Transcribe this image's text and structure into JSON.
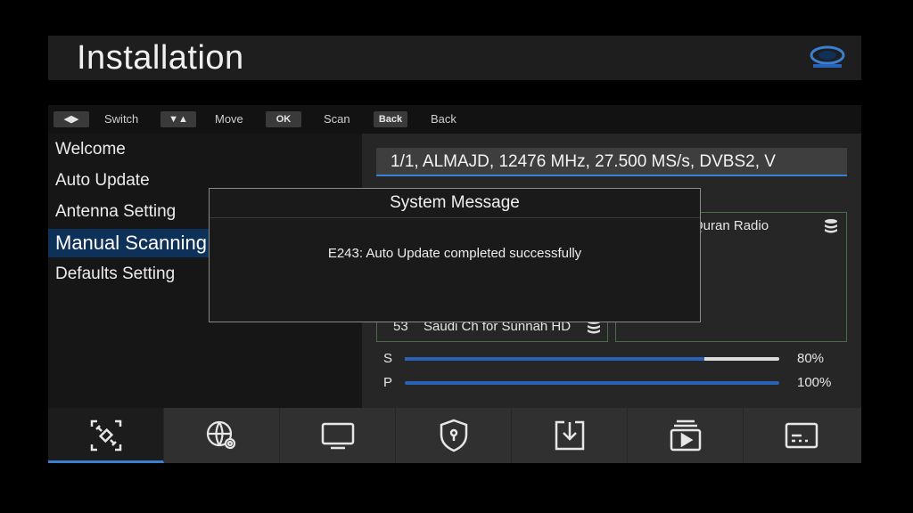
{
  "header": {
    "title": "Installation"
  },
  "hints": {
    "keys": [
      "◀▶",
      "▼▲",
      "OK",
      "Back"
    ],
    "labels": [
      "Switch",
      "Move",
      "Scan",
      "Back"
    ]
  },
  "menu": {
    "items": [
      "Welcome",
      "Auto Update",
      "Antenna Setting",
      "Manual Scanning",
      "Defaults Setting"
    ],
    "selected": "Manual Scanning"
  },
  "transponder": {
    "value": "1/1, ALMAJD, 12476 MHz, 27.500 MS/s, DVBS2, V"
  },
  "channels": {
    "left": {
      "number": "53",
      "name": "Saudi Ch for Sunnah HD"
    },
    "right": {
      "name": "Quran Radio"
    }
  },
  "signal": {
    "strength": {
      "label": "S",
      "value": "80%",
      "level": 80
    },
    "quality": {
      "label": "P",
      "value": "100%",
      "level": 100
    }
  },
  "dialog": {
    "title": "System Message",
    "message": "E243: Auto Update completed successfully"
  },
  "nav": {
    "icons": [
      "satellite-icon",
      "network-settings-icon",
      "tv-icon",
      "security-shield-icon",
      "download-icon",
      "media-playlist-icon",
      "subtitle-icon"
    ],
    "active": "satellite-icon"
  },
  "colors": {
    "accent": "#3a7fd0",
    "selected_bg": "#0d3158",
    "bar_fill": "#2a62b8"
  }
}
